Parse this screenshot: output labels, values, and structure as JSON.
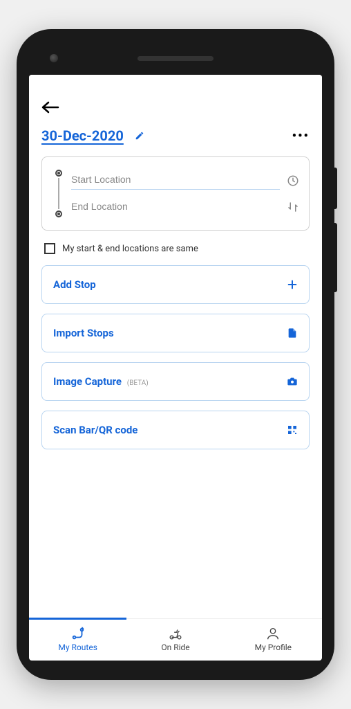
{
  "header": {
    "date_label": "30-Dec-2020"
  },
  "locations": {
    "start_placeholder": "Start Location",
    "end_placeholder": "End Location",
    "same_locations_label": "My start & end locations are same"
  },
  "actions": {
    "add_stop": "Add Stop",
    "import_stops": "Import Stops",
    "image_capture": "Image Capture",
    "image_capture_badge": "(BETA)",
    "scan_code": "Scan Bar/QR code"
  },
  "nav": {
    "routes": "My Routes",
    "ride": "On Ride",
    "profile": "My Profile"
  }
}
